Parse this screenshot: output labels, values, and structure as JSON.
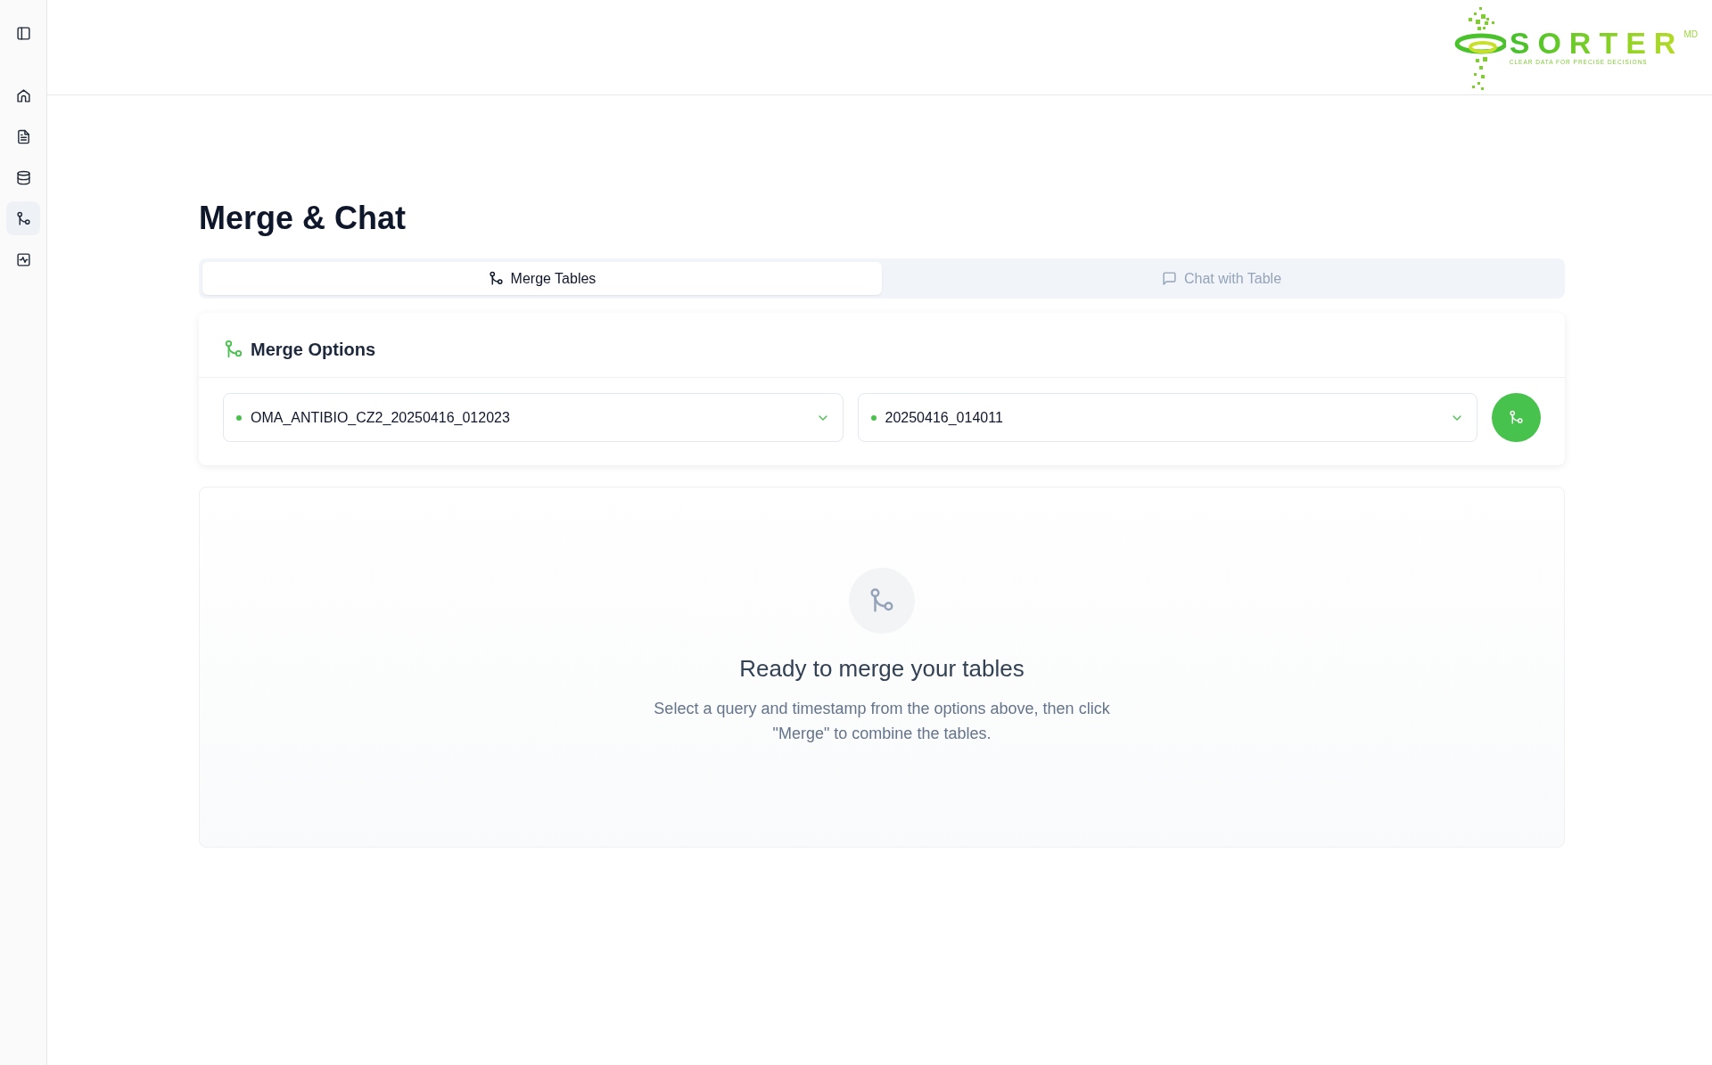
{
  "sidebar": {
    "items": [
      {
        "kind": "home",
        "selected": false
      },
      {
        "kind": "document",
        "selected": false
      },
      {
        "kind": "database",
        "selected": false
      },
      {
        "kind": "merge",
        "selected": true
      },
      {
        "kind": "activity",
        "selected": false
      }
    ]
  },
  "logo": {
    "name": "SORTER",
    "mark": "MD",
    "tagline": "CLEAR DATA FOR PRECISE DECISIONS"
  },
  "page": {
    "title": "Merge & Chat"
  },
  "tabs": [
    {
      "label": "Merge Tables",
      "kind": "merge",
      "selected": true
    },
    {
      "label": "Chat with Table",
      "kind": "chat",
      "selected": false
    }
  ],
  "merge_options": {
    "title": "Merge Options",
    "selects": [
      {
        "value": "OMA_ANTIBIO_CZ2_20250416_012023"
      },
      {
        "value": "20250416_014011"
      }
    ]
  },
  "empty_state": {
    "title": "Ready to merge your tables",
    "text": "Select a query and timestamp from the options above, then click \"Merge\" to combine the tables."
  }
}
